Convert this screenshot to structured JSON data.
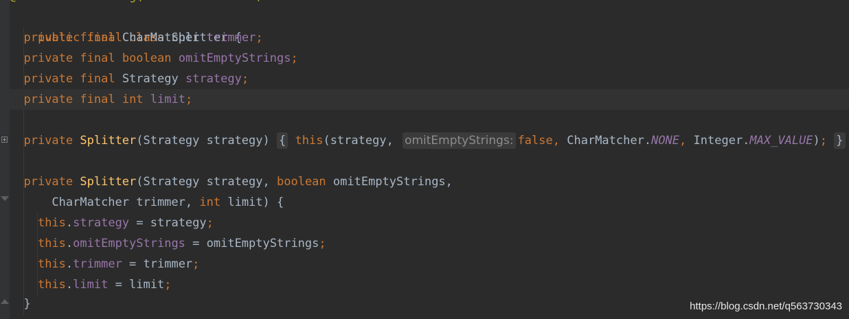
{
  "editor": {
    "partial_top_line": "@VisibleForTesting(Annotated = true)",
    "class_decl": {
      "kw_public": "public",
      "kw_final": "final",
      "kw_class": "class",
      "name": "Splitter",
      "brace": "{"
    },
    "fields": [
      {
        "mod1": "private",
        "mod2": "final",
        "type": "CharMatcher",
        "name": "trimmer",
        "semi": ";"
      },
      {
        "mod1": "private",
        "mod2": "final",
        "type": "boolean",
        "name": "omitEmptyStrings",
        "semi": ";"
      },
      {
        "mod1": "private",
        "mod2": "final",
        "type": "Strategy",
        "name": "strategy",
        "semi": ";"
      },
      {
        "mod1": "private",
        "mod2": "final",
        "type": "int",
        "name": "limit",
        "semi": ";"
      }
    ],
    "ctor1": {
      "mod": "private",
      "name": "Splitter",
      "params": "(Strategy strategy)",
      "open": "{",
      "this_kw": "this",
      "call_open": "(strategy,",
      "hint": "omitEmptyStrings:",
      "arg_false": "false",
      "comma1": ",",
      "charmatcher": "CharMatcher.",
      "none": "NONE",
      "comma2": ",",
      "integer": "Integer.",
      "max_value": "MAX_VALUE",
      "call_close": ")",
      "semi": ";",
      "close": "}"
    },
    "ctor2": {
      "mod": "private",
      "name": "Splitter",
      "params_a": "(Strategy strategy,",
      "kw_boolean": "boolean",
      "params_b": "omitEmptyStrings,",
      "cont_type": "CharMatcher trimmer,",
      "kw_int": "int",
      "cont_end": "limit) {",
      "assignments": [
        {
          "this_kw": "this",
          "dot": ".",
          "field": "strategy",
          "rhs": " = strategy",
          "semi": ";"
        },
        {
          "this_kw": "this",
          "dot": ".",
          "field": "omitEmptyStrings",
          "rhs": " = omitEmptyStrings",
          "semi": ";"
        },
        {
          "this_kw": "this",
          "dot": ".",
          "field": "trimmer",
          "rhs": " = trimmer",
          "semi": ";"
        },
        {
          "this_kw": "this",
          "dot": ".",
          "field": "limit",
          "rhs": " = limit",
          "semi": ";"
        }
      ],
      "close": "}"
    }
  },
  "watermark": "https://blog.csdn.net/q563730343",
  "colors": {
    "background": "#2b2b2b",
    "keyword": "#cc7832",
    "field": "#9876aa",
    "method": "#ffc66d",
    "text": "#a9b7c6"
  }
}
